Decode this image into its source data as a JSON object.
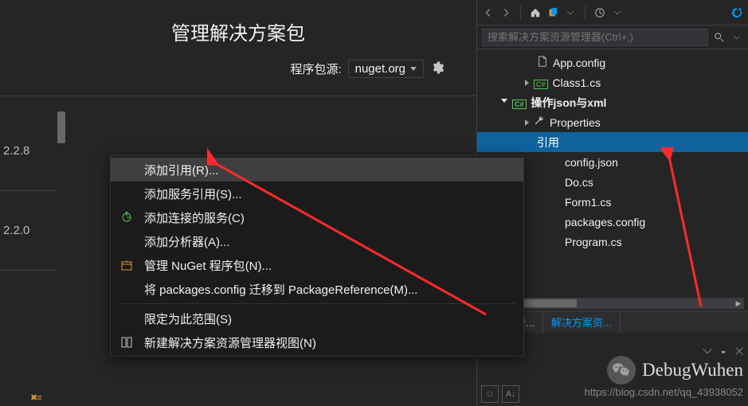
{
  "header": {
    "title": "管理解决方案包",
    "source_label": "程序包源:",
    "source_value": "nuget.org"
  },
  "versions": [
    "2.2.8",
    "2.2.0"
  ],
  "explorer": {
    "search_placeholder": "搜索解决方案资源管理器(Ctrl+;)",
    "items": [
      {
        "label": "App.config",
        "icon": "file",
        "indent": 1
      },
      {
        "label": "Class1.cs",
        "icon": "cs",
        "indent": 1,
        "expand": "closed"
      },
      {
        "label": "操作json与xml",
        "icon": "csproj",
        "indent": 2,
        "bold": true,
        "expand": "open"
      },
      {
        "label": "Properties",
        "icon": "wrench",
        "indent": 3,
        "expand": "closed"
      },
      {
        "label": "引用",
        "icon": "",
        "indent": 3,
        "selected": true
      },
      {
        "label": "config.json",
        "icon": "",
        "indent": 4
      },
      {
        "label": "Do.cs",
        "icon": "",
        "indent": 4
      },
      {
        "label": "Form1.cs",
        "icon": "",
        "indent": 4
      },
      {
        "label": "packages.config",
        "icon": "",
        "indent": 4
      },
      {
        "label": "Program.cs",
        "icon": "",
        "indent": 4
      }
    ],
    "tabs": [
      "队资源管...",
      "解决方案资..."
    ]
  },
  "context_menu": [
    {
      "label": "添加引用(R)...",
      "icon": "",
      "hover": true
    },
    {
      "label": "添加服务引用(S)...",
      "icon": ""
    },
    {
      "label": "添加连接的服务(C)",
      "icon": "service"
    },
    {
      "label": "添加分析器(A)...",
      "icon": ""
    },
    {
      "label": "管理 NuGet 程序包(N)...",
      "icon": "nuget"
    },
    {
      "label": "将 packages.config 迁移到 PackageReference(M)...",
      "icon": ""
    },
    {
      "sep": true
    },
    {
      "label": "限定为此范围(S)",
      "icon": ""
    },
    {
      "label": "新建解决方案资源管理器视图(N)",
      "icon": "view"
    }
  ],
  "watermark": {
    "name": "DebugWuhen",
    "url": "https://blog.csdn.net/qq_43938052"
  }
}
